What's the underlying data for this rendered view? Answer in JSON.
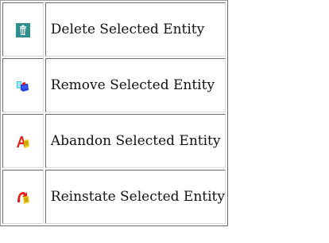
{
  "rows": [
    {
      "icon": "trash-can-icon",
      "label": "Delete Selected Entity"
    },
    {
      "icon": "remove-entity-icon",
      "label": "Remove Selected Entity"
    },
    {
      "icon": "abandon-entity-icon",
      "label": "Abandon Selected Entity"
    },
    {
      "icon": "reinstate-entity-icon",
      "label": "Reinstate Selected Entity"
    }
  ],
  "colors": {
    "delete_icon_bg": "#2f8f8c",
    "remove_icon_blue": "#1f3fd8",
    "remove_icon_cyan": "#43c8f0",
    "abandon_icon_red": "#e0201a",
    "abandon_icon_yellow": "#f2d21a",
    "reinstate_icon_red": "#e0201a",
    "reinstate_icon_yellow": "#f2d21a"
  }
}
